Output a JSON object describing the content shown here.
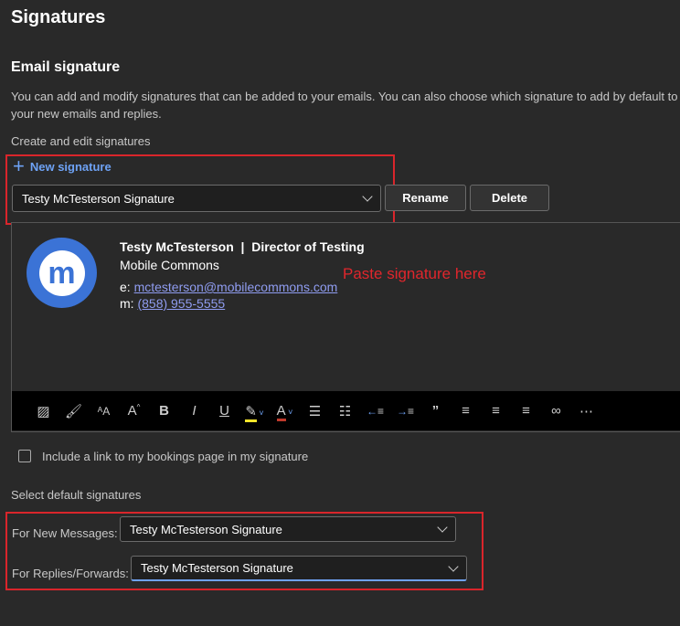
{
  "header": {
    "title": "Signatures"
  },
  "section": {
    "title": "Email signature",
    "description": "You can add and modify signatures that can be added to your emails. You can also choose which signature to add by default to your new emails and replies.",
    "create_label": "Create and edit signatures",
    "new_signature": "New signature"
  },
  "signature_select": {
    "value": "Testy McTesterson Signature"
  },
  "buttons": {
    "rename": "Rename",
    "delete": "Delete"
  },
  "signature": {
    "logo_letter": "m",
    "name_line": "Testy McTesterson  |  Director of Testing",
    "company": "Mobile Commons",
    "email_prefix": "e: ",
    "email": "mctesterson@mobilecommons.com",
    "phone_prefix": "m: ",
    "phone": "(858) 955-5555",
    "annotation": "Paste signature here"
  },
  "toolbar": {
    "icons": [
      "image-icon",
      "format-painter-icon",
      "font-size-icon",
      "font-size-increase-icon",
      "bold-icon",
      "italic-icon",
      "underline-icon",
      "highlight-icon",
      "font-color-icon",
      "bullets-icon",
      "numbering-icon",
      "decrease-indent-icon",
      "increase-indent-icon",
      "quote-icon",
      "align-left-icon",
      "align-center-icon",
      "align-right-icon",
      "link-icon",
      "more-icon"
    ]
  },
  "bookings": {
    "label": "Include a link to my bookings page in my signature",
    "checked": false
  },
  "defaults": {
    "title": "Select default signatures",
    "new_label": "For New Messages:",
    "new_value": "Testy McTesterson Signature",
    "reply_label": "For Replies/Forwards:",
    "reply_value": "Testy McTesterson Signature"
  },
  "colors": {
    "accent": "#6ea2f5",
    "highlight_box": "#d9252b",
    "logo": "#3b73d6"
  }
}
